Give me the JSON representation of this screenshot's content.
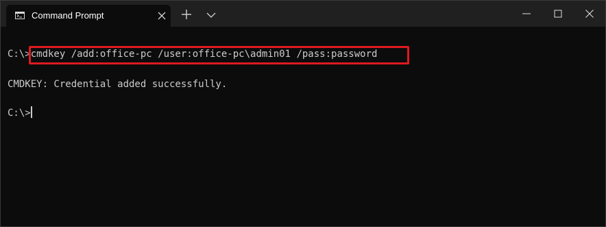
{
  "window": {
    "tab_title": "Command Prompt",
    "tab_icon": "cmd-icon",
    "controls": [
      "new-tab-icon",
      "chevron-down-icon",
      "minimize-icon",
      "maximize-icon",
      "close-icon"
    ]
  },
  "terminal": {
    "lines": [
      {
        "prompt": "C:\\>",
        "command": "cmdkey /add:office-pc /user:office-pc\\admin01 /pass:password"
      },
      {
        "output": "CMDKEY: Credential added successfully."
      },
      {
        "prompt": "C:\\>",
        "command": ""
      }
    ],
    "highlight_color": "#e0191f",
    "text_color": "#cccccc",
    "background_color": "#0c0c0c"
  }
}
